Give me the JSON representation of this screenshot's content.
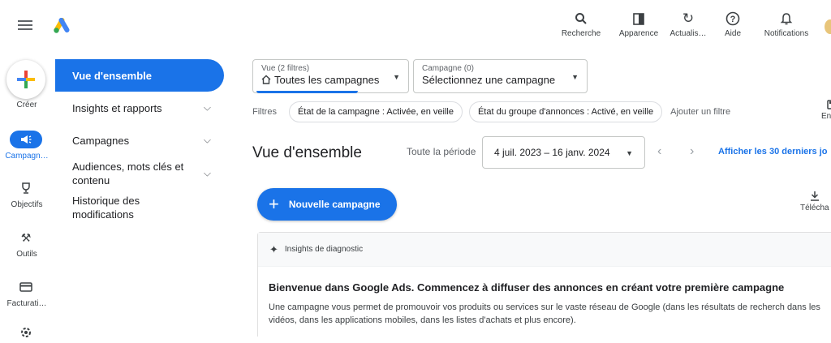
{
  "topbar": {
    "actions": [
      {
        "label": "Recherche",
        "icon": "search-icon",
        "glyph": "⚲"
      },
      {
        "label": "Apparence",
        "icon": "appearance-icon",
        "glyph": "▥"
      },
      {
        "label": "Actualis…",
        "icon": "refresh-icon",
        "glyph": "↻"
      },
      {
        "label": "Aide",
        "icon": "help-icon",
        "glyph": "?"
      },
      {
        "label": "Notifications",
        "icon": "bell-icon",
        "glyph": "🔔"
      }
    ]
  },
  "rail": {
    "create_label": "Créer",
    "items": [
      {
        "label": "Campagn…",
        "icon": "megaphone-icon",
        "glyph": "📢",
        "active": true
      },
      {
        "label": "Objectifs",
        "icon": "trophy-icon",
        "glyph": "🏆",
        "active": false
      },
      {
        "label": "Outils",
        "icon": "tools-icon",
        "glyph": "⚒",
        "active": false
      },
      {
        "label": "Facturati…",
        "icon": "billing-icon",
        "glyph": "▭",
        "active": false
      }
    ]
  },
  "nav": {
    "items": [
      {
        "label": "Vue d'ensemble",
        "active": true,
        "chevron": false
      },
      {
        "label": "Insights et rapports",
        "active": false,
        "chevron": true
      },
      {
        "label": "Campagnes",
        "active": false,
        "chevron": true
      },
      {
        "label": "Audiences, mots clés et contenu",
        "active": false,
        "chevron": true
      },
      {
        "label": "Historique des modifications",
        "active": false,
        "chevron": false
      }
    ]
  },
  "view_select": {
    "small": "Vue (2 filtres)",
    "value": "Toutes les campagnes"
  },
  "campaign_select": {
    "small": "Campagne (0)",
    "value": "Sélectionnez une campagne"
  },
  "filters": {
    "label": "Filtres",
    "chips": [
      "État de la campagne : Activée, en veille",
      "État du groupe d'annonces : Activé, en veille"
    ],
    "add": "Ajouter un filtre",
    "save": "Enreg"
  },
  "overview": {
    "title": "Vue d'ensemble",
    "period_label": "Toute la période",
    "date_range": "4 juil. 2023 – 16 janv. 2024",
    "last30": "Afficher les 30 derniers jo"
  },
  "new_campaign": "Nouvelle campagne",
  "download": "Télécha",
  "card": {
    "header": "Insights de diagnostic",
    "title": "Bienvenue dans Google Ads. Commencez à diffuser des annonces en créant votre première campagne",
    "body": "Une campagne vous permet de promouvoir vos produits ou services sur le vaste réseau de Google (dans les résultats de recherch dans les vidéos, dans les applications mobiles, dans les listes d'achats et plus encore)."
  },
  "colors": {
    "accent": "#1a73e8",
    "text": "#202124",
    "muted": "#5f6368"
  }
}
